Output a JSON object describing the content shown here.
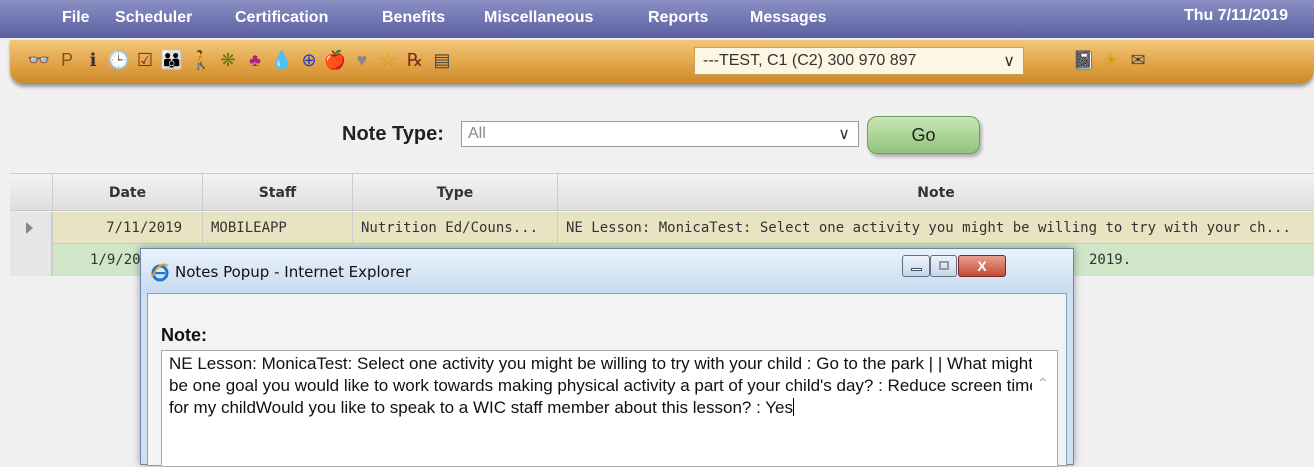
{
  "menu": {
    "items": [
      "File",
      "Scheduler",
      "Certification",
      "Benefits",
      "Miscellaneous",
      "Reports",
      "Messages"
    ],
    "date": "Thu 7/11/2019"
  },
  "toolbar": {
    "icons": [
      {
        "name": "binoculars-icon",
        "glyph": "👓",
        "color": "#6b3a12"
      },
      {
        "name": "p-icon",
        "glyph": "P",
        "color": "#7a5a10"
      },
      {
        "name": "info-card-icon",
        "glyph": "ℹ",
        "color": "#333"
      },
      {
        "name": "clock-icon",
        "glyph": "🕒",
        "color": "#333"
      },
      {
        "name": "checkbox-icon",
        "glyph": "☑",
        "color": "#7a2a1e"
      },
      {
        "name": "family-icon",
        "glyph": "👪",
        "color": "#b0217f"
      },
      {
        "name": "person-icon",
        "glyph": "🚶",
        "color": "#b0217f"
      },
      {
        "name": "food-group-icon",
        "glyph": "❋",
        "color": "#6b7a10"
      },
      {
        "name": "people-icon",
        "glyph": "♣",
        "color": "#b0217f"
      },
      {
        "name": "drop-icon",
        "glyph": "💧",
        "color": "#b02020"
      },
      {
        "name": "plus-circle-icon",
        "glyph": "⊕",
        "color": "#1f3fc7"
      },
      {
        "name": "apple-icon",
        "glyph": "🍎",
        "color": "#c02020"
      },
      {
        "name": "heart-icon",
        "glyph": "♥",
        "color": "#888"
      },
      {
        "name": "star-icon",
        "glyph": "☆",
        "color": "#c9a400"
      },
      {
        "name": "prescription-icon",
        "glyph": "℞",
        "color": "#7a2a1e"
      },
      {
        "name": "card-icon",
        "glyph": "▤",
        "color": "#444"
      }
    ],
    "client_select": "---TEST, C1 (C2) 300 970 897",
    "right_icons": [
      {
        "name": "notepad-icon",
        "glyph": "📓",
        "color": "#b02020"
      },
      {
        "name": "lightbulb-icon",
        "glyph": "☀",
        "color": "#c9a400"
      },
      {
        "name": "envelope-icon",
        "glyph": "✉",
        "color": "#444"
      }
    ]
  },
  "filter": {
    "label": "Note Type:",
    "selected": "All",
    "go_label": "Go"
  },
  "grid": {
    "headers": [
      "Date",
      "Staff",
      "Type",
      "Note"
    ],
    "rows": [
      {
        "date": "7/11/2019",
        "staff": "MOBILEAPP",
        "type": "Nutrition Ed/Couns...",
        "note": "NE Lesson: MonicaTest: Select one activity you might be willing to try with your ch..."
      },
      {
        "date": "1/9/20",
        "staff": "",
        "type": "",
        "note": "2019."
      }
    ]
  },
  "popup": {
    "title": "Notes Popup - Internet Explorer",
    "note_label": "Note:",
    "note_text": "NE Lesson: MonicaTest: Select one activity you might be willing to try with your child : Go to the park |  | What might be one goal you would like to work towards making physical activity a part of your child's day? : Reduce screen time for my childWould you like to speak to a WIC staff member about this lesson? : Yes",
    "close_label": "X"
  }
}
